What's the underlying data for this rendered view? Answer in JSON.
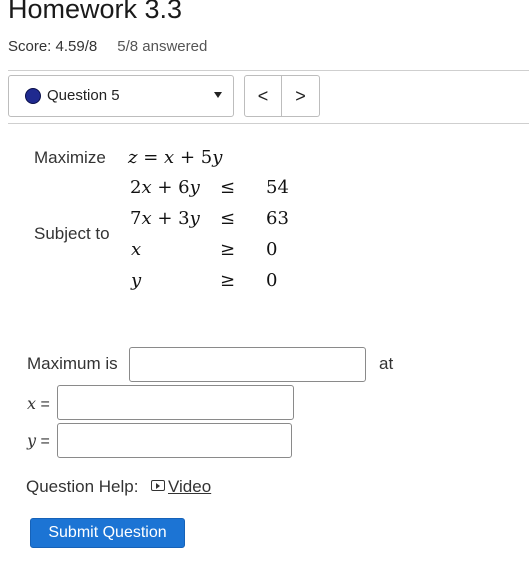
{
  "header": {
    "title": "Homework 3.3",
    "score": "Score: 4.59/8",
    "answered": "5/8 answered"
  },
  "question_nav": {
    "selected": "Question 5",
    "prev_symbol": "<",
    "next_symbol": ">",
    "status_color": "#1f2a8f"
  },
  "problem": {
    "maximize_label": "Maximize",
    "subject_to_label": "Subject to",
    "objective": {
      "lhs": "z",
      "eq": "=",
      "term1": "x",
      "plus": "+",
      "coef": "5",
      "var": "y"
    },
    "constraints": [
      {
        "a": "2",
        "x": "x",
        "op": "+",
        "b": "6",
        "y": "y",
        "rel": "≤",
        "rhs": "54"
      },
      {
        "a": "7",
        "x": "x",
        "op": "+",
        "b": "3",
        "y": "y",
        "rel": "≤",
        "rhs": "63"
      },
      {
        "var": "x",
        "rel": "≥",
        "rhs": "0"
      },
      {
        "var": "y",
        "rel": "≥",
        "rhs": "0"
      }
    ]
  },
  "answer": {
    "maximum_label": "Maximum is",
    "at_label": "at",
    "x_label": "x",
    "y_label": "y",
    "equals": "=",
    "maximum_value": "",
    "x_value": "",
    "y_value": ""
  },
  "help": {
    "label": "Question Help:",
    "video_label": "Video"
  },
  "submit_label": "Submit Question",
  "accent_color": "#1c74d4"
}
